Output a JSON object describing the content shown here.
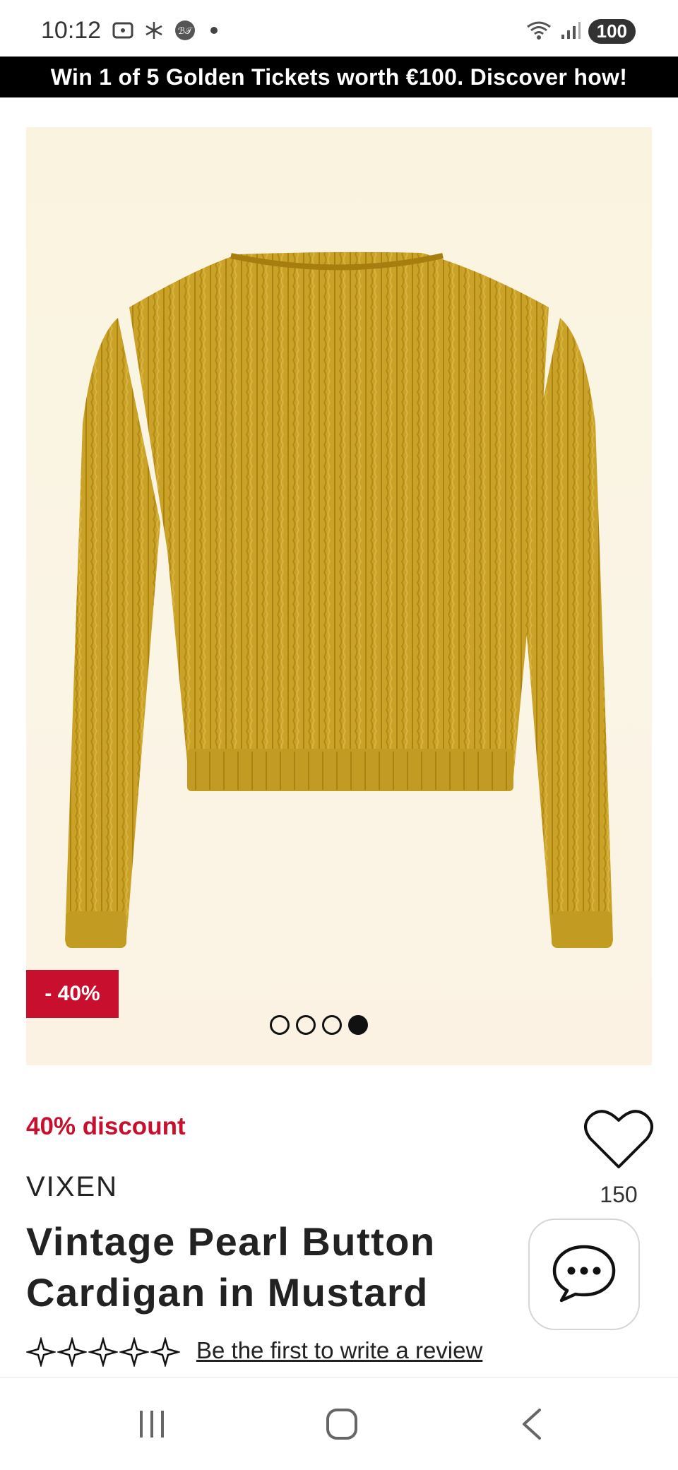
{
  "status_bar": {
    "time": "10:12",
    "battery": "100",
    "icons": [
      "screenshot-icon",
      "snowflake-icon",
      "app-badge-icon",
      "notification-dot",
      "wifi-icon",
      "signal-icon"
    ]
  },
  "promo_banner": {
    "text": "Win 1 of 5 Golden Tickets worth €100. Discover how!"
  },
  "gallery": {
    "discount_badge": "- 40%",
    "dots_count": 4,
    "active_dot": 4,
    "image_alt": "mustard cable knit cardigan back view"
  },
  "product": {
    "discount_text": "40% discount",
    "brand": "VIXEN",
    "title": "Vintage Pearl Button Cardigan in Mustard",
    "favorites_count": "150",
    "rating_stars": 0,
    "review_link": "Be the first to write a review"
  },
  "colors": {
    "accent": "#c8102e",
    "sweater": "#c9a227",
    "banner": "#000000"
  },
  "nav": {
    "icons": [
      "recent-apps-icon",
      "home-icon",
      "back-icon"
    ]
  }
}
